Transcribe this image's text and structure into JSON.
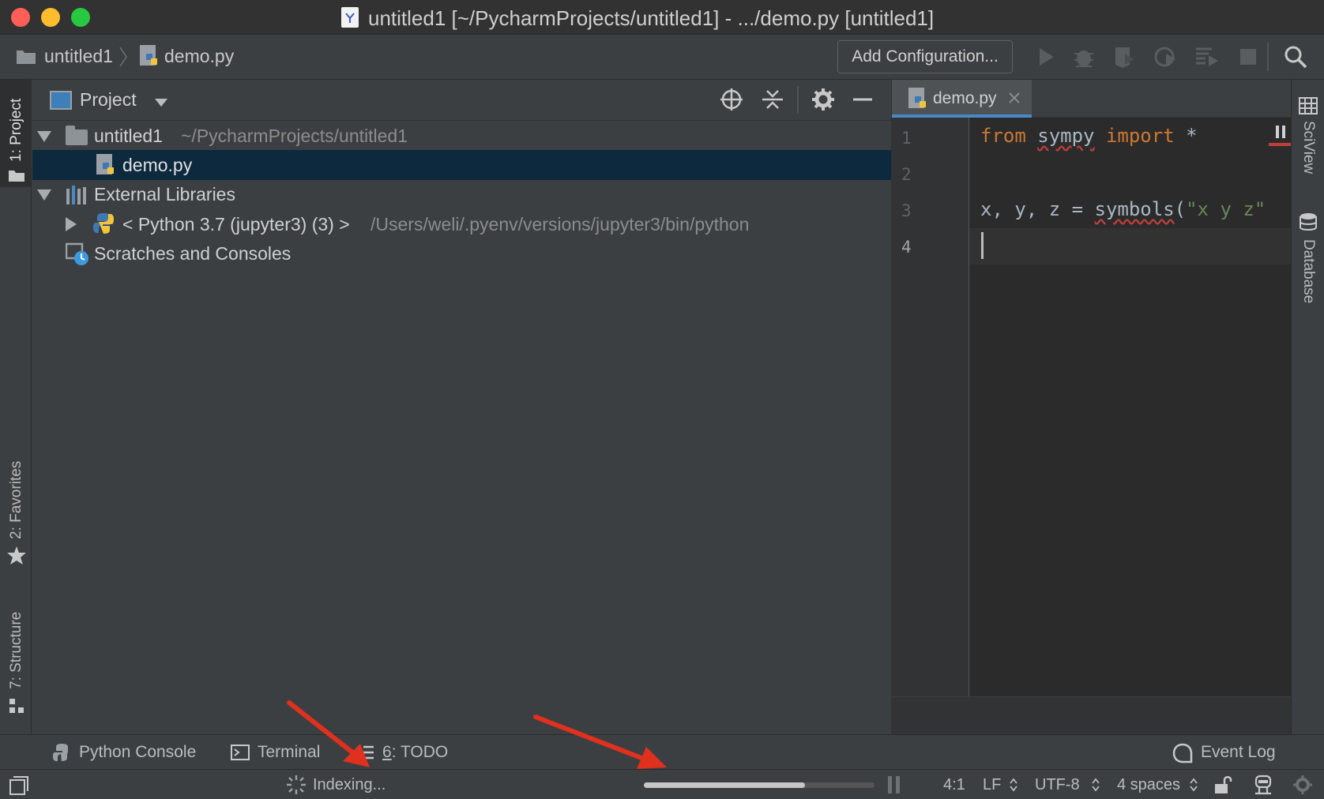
{
  "window": {
    "title": "untitled1 [~/PycharmProjects/untitled1] - .../demo.py [untitled1]",
    "traffic_lights": {
      "close": "#ff5f57",
      "minimize": "#febc2e",
      "zoom": "#28c840"
    }
  },
  "navbar": {
    "breadcrumb_project": "untitled1",
    "breadcrumb_file": "demo.py",
    "add_configuration_label": "Add Configuration...",
    "icons": [
      "run-icon",
      "debug-icon",
      "coverage-icon",
      "profile-icon",
      "concurrency-icon",
      "stop-icon",
      "search-icon"
    ]
  },
  "left_tabs": {
    "project": "1: Project",
    "favorites": "2: Favorites",
    "structure": "7: Structure"
  },
  "right_tabs": {
    "sciview": "SciView",
    "database": "Database"
  },
  "project_panel": {
    "title": "Project",
    "tree": {
      "root_name": "untitled1",
      "root_path": "~/PycharmProjects/untitled1",
      "file": "demo.py",
      "external_libraries": "External Libraries",
      "python_sdk": "< Python 3.7 (jupyter3) (3) >",
      "python_path": "/Users/weli/.pyenv/versions/jupyter3/bin/python",
      "scratches": "Scratches and Consoles"
    }
  },
  "editor": {
    "tab_label": "demo.py",
    "line_numbers": [
      "1",
      "2",
      "3",
      "4"
    ],
    "lines": {
      "l1_from": "from",
      "l1_module": "sympy",
      "l1_import": "import",
      "l1_star": "*",
      "l3_vars": "x, y, z = ",
      "l3_func": "symbols",
      "l3_paren": "(",
      "l3_string": "\"x y z\""
    }
  },
  "bottom_tools": {
    "python_console": "Python Console",
    "terminal": "Terminal",
    "todo_num": "6",
    "todo_label": ": TODO",
    "event_log": "Event Log"
  },
  "status": {
    "indexing": "Indexing...",
    "indexing_progress": 0.7,
    "position": "4:1",
    "line_sep": "LF",
    "encoding": "UTF-8",
    "indent": "4 spaces"
  },
  "colors": {
    "accent_tab": "#4a88c7",
    "selection": "#0d293e",
    "keyword": "#cc7832",
    "string": "#6a8759",
    "annotation_arrow": "#e0301e"
  }
}
